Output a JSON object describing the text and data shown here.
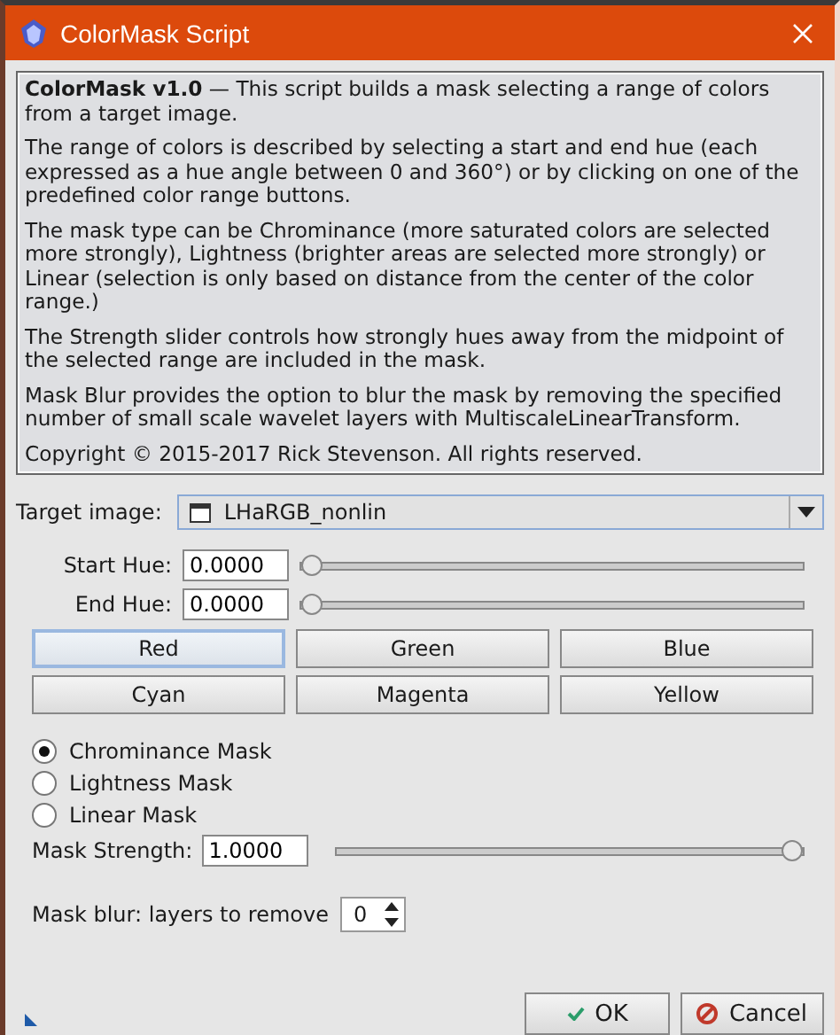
{
  "window": {
    "title": "ColorMask Script"
  },
  "description": [
    "**ColorMask v1.0** — This script builds a mask selecting a range of colors from a target image.",
    "The range of colors is described by selecting a start and end hue (each expressed as a hue angle between 0 and 360°) or by clicking on one of the predefined color range buttons.",
    "The mask type can be Chrominance (more saturated colors are selected more strongly), Lightness (brighter areas are selected more strongly) or Linear (selection is only based on distance from the center of the color range.)",
    "The Strength slider controls how strongly hues away from the midpoint of the selected range are included in the mask.",
    "Mask Blur provides the option to blur the mask by removing the specified number of small scale wavelet layers with MultiscaleLinearTransform.",
    "Copyright © 2015-2017 Rick Stevenson. All rights reserved."
  ],
  "target_image": {
    "label": "Target image:",
    "value": "LHaRGB_nonlin"
  },
  "hue_fields": [
    {
      "label": "Start Hue:",
      "value": "0.0000",
      "level": 0
    },
    {
      "label": "End Hue:",
      "value": "0.0000",
      "level": 0
    }
  ],
  "color_buttons": [
    {
      "label": "Red",
      "selected": true
    },
    {
      "label": "Green",
      "selected": false
    },
    {
      "label": "Blue",
      "selected": false
    },
    {
      "label": "Cyan",
      "selected": false
    },
    {
      "label": "Magenta",
      "selected": false
    },
    {
      "label": "Yellow",
      "selected": false
    }
  ],
  "mask_types": [
    {
      "label": "Chrominance Mask",
      "selected": true
    },
    {
      "label": "Lightness Mask",
      "selected": false
    },
    {
      "label": "Linear Mask",
      "selected": false
    }
  ],
  "strength": {
    "label": "Mask Strength:",
    "value": "1.0000",
    "level": 1
  },
  "blur": {
    "label": "Mask blur: layers to remove",
    "value": "0"
  },
  "buttons": [
    {
      "label": "OK",
      "kind": "ok"
    },
    {
      "label": "Cancel",
      "kind": "cancel"
    }
  ]
}
